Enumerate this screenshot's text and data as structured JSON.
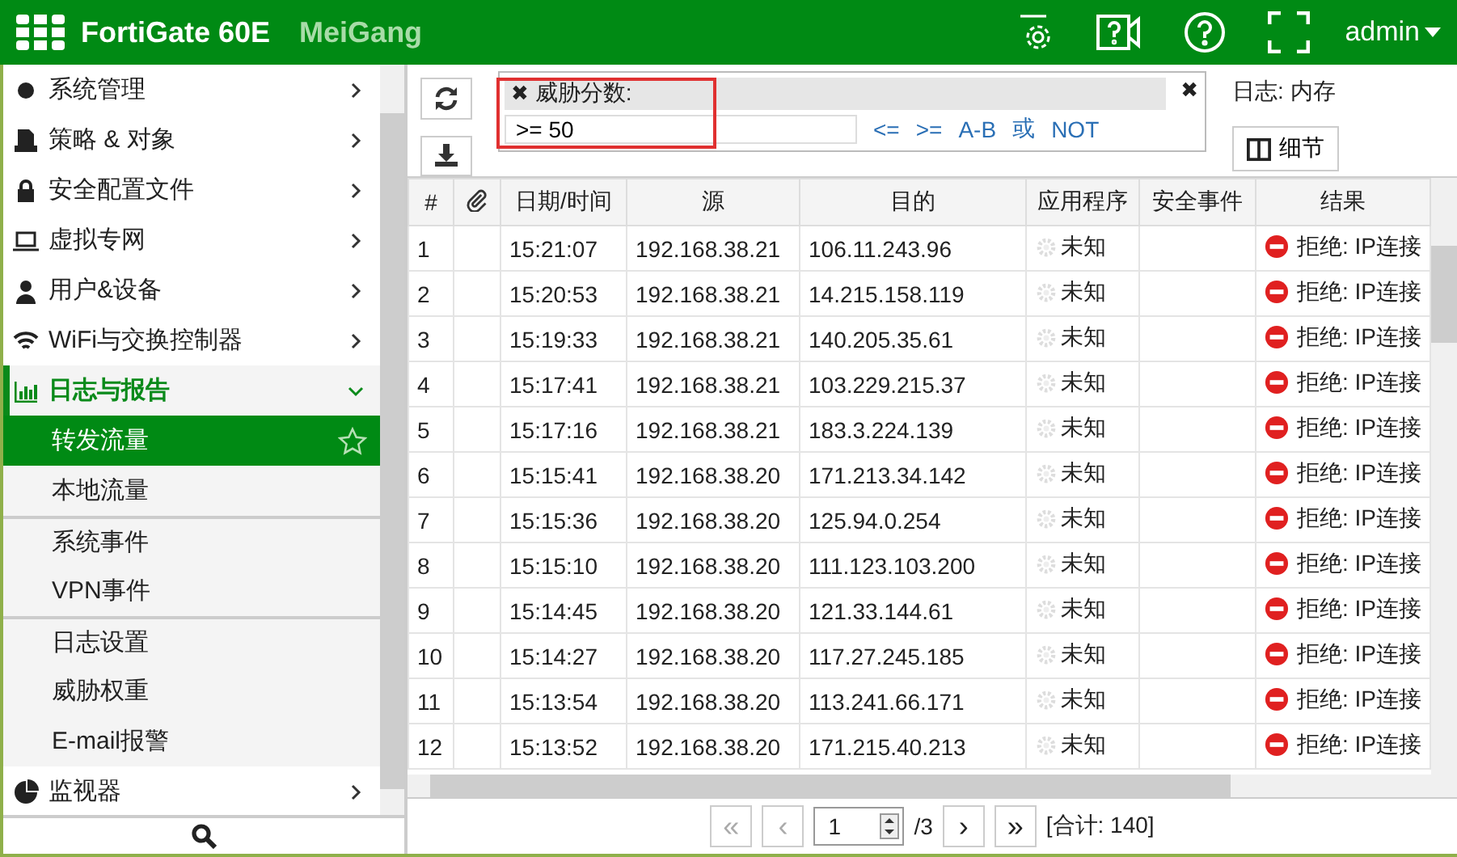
{
  "header": {
    "product": "FortiGate 60E",
    "hostname": "MeiGang",
    "user": "admin"
  },
  "sidebar": {
    "items": [
      {
        "kind": "group",
        "label": "系统管理",
        "expanded": false
      },
      {
        "kind": "group",
        "label": "策略 & 对象",
        "expanded": false
      },
      {
        "kind": "group",
        "label": "安全配置文件",
        "expanded": false
      },
      {
        "kind": "group",
        "label": "虚拟专网",
        "expanded": false
      },
      {
        "kind": "group",
        "label": "用户&设备",
        "expanded": false
      },
      {
        "kind": "group",
        "label": "WiFi与交换控制器",
        "expanded": false
      },
      {
        "kind": "group",
        "label": "日志与报告",
        "expanded": true,
        "children": [
          {
            "label": "转发流量",
            "selected": true,
            "divider_before": false
          },
          {
            "label": "本地流量",
            "selected": false,
            "divider_before": false
          },
          {
            "label": "系统事件",
            "selected": false,
            "divider_before": true
          },
          {
            "label": "VPN事件",
            "selected": false,
            "divider_before": false
          },
          {
            "label": "日志设置",
            "selected": false,
            "divider_before": true
          },
          {
            "label": "威胁权重",
            "selected": false,
            "divider_before": false
          },
          {
            "label": "E-mail报警",
            "selected": false,
            "divider_before": false
          }
        ]
      },
      {
        "kind": "group",
        "label": "监视器",
        "expanded": false
      }
    ]
  },
  "filter": {
    "remove": "✖",
    "field": "威胁分数:",
    "close": "✖",
    "value": ">= 50",
    "operators": [
      "<=",
      ">=",
      "A-B",
      "或",
      "NOT"
    ]
  },
  "log_source": "日志: 内存",
  "details_button": "细节",
  "table": {
    "columns": [
      "#",
      "",
      "日期/时间",
      "源",
      "目的",
      "应用程序",
      "安全事件",
      "结果"
    ],
    "rows": [
      [
        "1",
        "",
        "15:21:07",
        "192.168.38.21",
        "106.11.243.96",
        "未知",
        "",
        "拒绝: IP连接"
      ],
      [
        "2",
        "",
        "15:20:53",
        "192.168.38.21",
        "14.215.158.119",
        "未知",
        "",
        "拒绝: IP连接"
      ],
      [
        "3",
        "",
        "15:19:33",
        "192.168.38.21",
        "140.205.35.61",
        "未知",
        "",
        "拒绝: IP连接"
      ],
      [
        "4",
        "",
        "15:17:41",
        "192.168.38.21",
        "103.229.215.37",
        "未知",
        "",
        "拒绝: IP连接"
      ],
      [
        "5",
        "",
        "15:17:16",
        "192.168.38.21",
        "183.3.224.139",
        "未知",
        "",
        "拒绝: IP连接"
      ],
      [
        "6",
        "",
        "15:15:41",
        "192.168.38.20",
        "171.213.34.142",
        "未知",
        "",
        "拒绝: IP连接"
      ],
      [
        "7",
        "",
        "15:15:36",
        "192.168.38.20",
        "125.94.0.254",
        "未知",
        "",
        "拒绝: IP连接"
      ],
      [
        "8",
        "",
        "15:15:10",
        "192.168.38.20",
        "111.123.103.200",
        "未知",
        "",
        "拒绝: IP连接"
      ],
      [
        "9",
        "",
        "15:14:45",
        "192.168.38.20",
        "121.33.144.61",
        "未知",
        "",
        "拒绝: IP连接"
      ],
      [
        "10",
        "",
        "15:14:27",
        "192.168.38.20",
        "117.27.245.185",
        "未知",
        "",
        "拒绝: IP连接"
      ],
      [
        "11",
        "",
        "15:13:54",
        "192.168.38.20",
        "113.241.66.171",
        "未知",
        "",
        "拒绝: IP连接"
      ],
      [
        "12",
        "",
        "15:13:52",
        "192.168.38.20",
        "171.215.40.213",
        "未知",
        "",
        "拒绝: IP连接"
      ]
    ]
  },
  "pager": {
    "first": "«",
    "previous": "‹",
    "page": "1",
    "pages": "/3",
    "next": "›",
    "last": "»",
    "total": "[合计: 140]"
  }
}
